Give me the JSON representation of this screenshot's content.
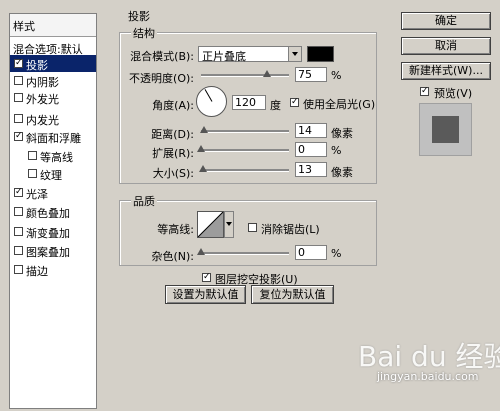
{
  "left_panel": {
    "header": "样式",
    "items": [
      {
        "label": "混合选项:默认",
        "checkbox": false,
        "checked": false,
        "selected": false
      },
      {
        "label": "投影",
        "checkbox": true,
        "checked": true,
        "selected": true
      },
      {
        "label": "内阴影",
        "checkbox": true,
        "checked": false,
        "selected": false
      },
      {
        "label": "外发光",
        "checkbox": true,
        "checked": false,
        "selected": false
      },
      {
        "label": "内发光",
        "checkbox": true,
        "checked": false,
        "selected": false
      },
      {
        "label": "斜面和浮雕",
        "checkbox": true,
        "checked": true,
        "selected": false
      },
      {
        "label": "等高线",
        "checkbox": true,
        "checked": false,
        "selected": false
      },
      {
        "label": "纹理",
        "checkbox": true,
        "checked": false,
        "selected": false
      },
      {
        "label": "光泽",
        "checkbox": true,
        "checked": true,
        "selected": false
      },
      {
        "label": "颜色叠加",
        "checkbox": true,
        "checked": false,
        "selected": false
      },
      {
        "label": "渐变叠加",
        "checkbox": true,
        "checked": false,
        "selected": false
      },
      {
        "label": "图案叠加",
        "checkbox": true,
        "checked": false,
        "selected": false
      },
      {
        "label": "描边",
        "checkbox": true,
        "checked": false,
        "selected": false
      }
    ]
  },
  "drop_shadow": {
    "title": "投影",
    "structure": {
      "title": "结构",
      "blend_mode_label": "混合模式(B):",
      "blend_mode_value": "正片叠底",
      "shadow_color": "#000000",
      "opacity_label": "不透明度(O):",
      "opacity_value": "75",
      "opacity_unit": "%",
      "angle_label": "角度(A):",
      "angle_value": "120",
      "angle_unit": "度",
      "global_light_label": "使用全局光(G)",
      "global_light_checked": true,
      "distance_label": "距离(D):",
      "distance_value": "14",
      "distance_unit": "像素",
      "spread_label": "扩展(R):",
      "spread_value": "0",
      "spread_unit": "%",
      "size_label": "大小(S):",
      "size_value": "13",
      "size_unit": "像素"
    },
    "quality": {
      "title": "品质",
      "contour_label": "等高线:",
      "antialias_label": "消除锯齿(L)",
      "antialias_checked": false,
      "noise_label": "杂色(N):",
      "noise_value": "0",
      "noise_unit": "%"
    },
    "knockout_label": "图层挖空投影(U)",
    "knockout_checked": true,
    "set_default_label": "设置为默认值",
    "reset_default_label": "复位为默认值"
  },
  "right_panel": {
    "ok_label": "确定",
    "cancel_label": "取消",
    "new_style_label": "新建样式(W)...",
    "preview_label": "预览(V)",
    "preview_checked": true
  },
  "watermark": {
    "brand": "Bai du 经验",
    "url": "jingyan.baidu.com"
  },
  "colors": {
    "dialog_bg": "#d4d0c8",
    "selection": "#0a246a",
    "preview_swatch": "#5a5a5a"
  }
}
